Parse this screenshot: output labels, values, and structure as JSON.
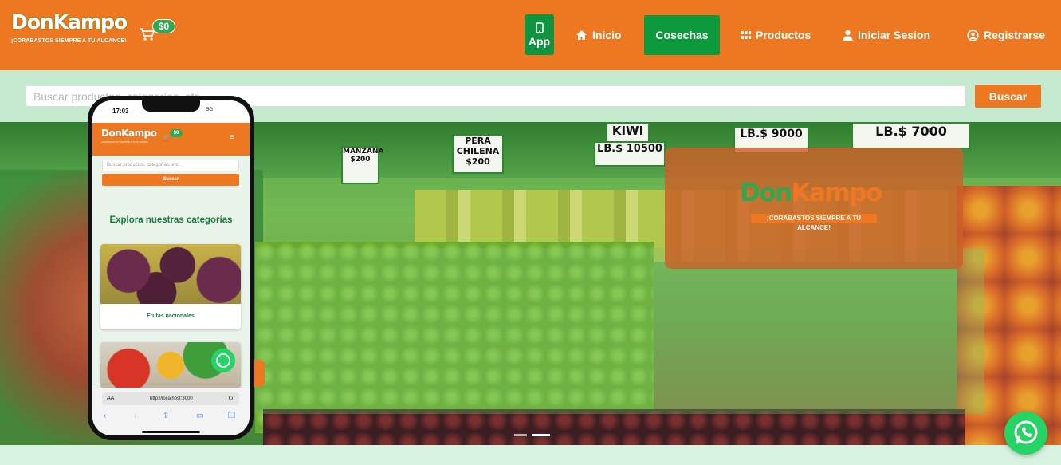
{
  "brand": {
    "name_part1": "Don",
    "name_part2": "Kampo",
    "tagline": "¡CORABASTOS SIEMPRE A TU ALCANCE!",
    "primary_color": "#ee7722",
    "accent_color": "#0d9a3c"
  },
  "cart": {
    "total": "$0",
    "icon": "cart-icon"
  },
  "nav": {
    "app": "App",
    "inicio": "Inicio",
    "cosechas": "Cosechas",
    "productos": "Productos",
    "iniciar_sesion": "Iniciar Sesion",
    "registrarse": "Registrarse"
  },
  "search": {
    "placeholder": "Buscar productos, categorías, etc.",
    "button": "Buscar"
  },
  "hero": {
    "promo_name_part1": "Don",
    "promo_name_part2": "Kampo",
    "promo_tagline": "¡CORABASTOS SIEMPRE A TU ALCANCE!",
    "signs": [
      "KIWI",
      "PERA CHILENA",
      "$200",
      "MANZANA",
      "$200",
      "LB.$ 10500",
      "LB.$ 9000",
      "LB.$ 7000"
    ]
  },
  "phone": {
    "time": "17:03",
    "network": "5G",
    "cart_total": "$0",
    "search_placeholder": "Buscar productos, categorías, etc.",
    "search_button": "Buscar",
    "section_title": "Explora nuestras categorías",
    "category_1": "Frutas nacionales",
    "browser_aa": "AA",
    "url": "http://localhost:3000"
  }
}
